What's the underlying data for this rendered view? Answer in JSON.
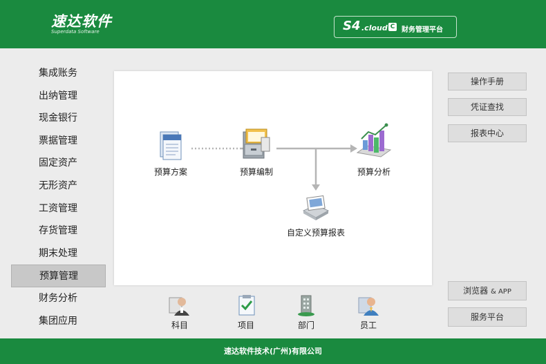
{
  "header": {
    "logo_cn": "速达软件",
    "logo_en": "Superdata Software",
    "product_s4": "S4",
    "product_cloud": ".cloud",
    "product_c": "C",
    "product_name": "财务管理平台"
  },
  "sidebar": {
    "items": [
      {
        "label": "集成账务"
      },
      {
        "label": "出纳管理"
      },
      {
        "label": "现金银行"
      },
      {
        "label": "票据管理"
      },
      {
        "label": "固定资产"
      },
      {
        "label": "无形资产"
      },
      {
        "label": "工资管理"
      },
      {
        "label": "存货管理"
      },
      {
        "label": "期末处理"
      },
      {
        "label": "预算管理",
        "active": true
      },
      {
        "label": "财务分析"
      },
      {
        "label": "集团应用"
      }
    ]
  },
  "flow": {
    "budget_plan": "预算方案",
    "budget_compile": "预算编制",
    "budget_analysis": "预算分析",
    "custom_report": "自定义预算报表"
  },
  "bottom": {
    "subject": "科目",
    "project": "项目",
    "department": "部门",
    "employee": "员工"
  },
  "right": {
    "manual": "操作手册",
    "voucher": "凭证查找",
    "report": "报表中心",
    "browser": "浏览器",
    "browser_amp": "& APP",
    "service": "服务平台"
  },
  "footer": {
    "company": "速达软件技术(广州)有限公司"
  },
  "colors": {
    "brand_green": "#1a8a3f",
    "active_nav": "#c8c8c8"
  }
}
